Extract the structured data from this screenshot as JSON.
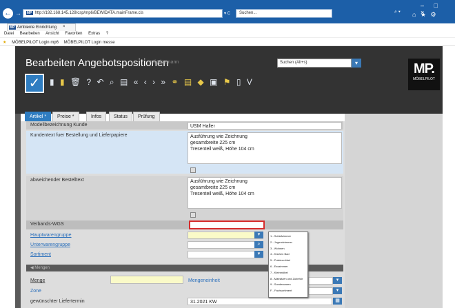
{
  "browser": {
    "url": "http://192.168.145.128/csp/mp6/BEWIDATA.mainFrame.cls",
    "address_controls": "▾ C",
    "search_placeholder": "Suchen...",
    "tab_title": "Ambiente Einrichtung",
    "tab_close": "×",
    "menu": [
      "Datei",
      "Bearbeiten",
      "Ansicht",
      "Favoriten",
      "Extras",
      "?"
    ],
    "favorites": [
      "MÖBELPILOT Login mp6",
      "MÖBELPILOT Login messe"
    ],
    "window_controls": "– □ ×",
    "tool_icons": "⌂ ★ ⚙",
    "search_icon": "⌕ ▾"
  },
  "app": {
    "title": "Bearbeiten Angebotspositionen",
    "user": "Uli Flottmann",
    "search_label": "Suchen (Alt+s)",
    "logo_big": "MP.",
    "logo_small": "MÖBELPILOT",
    "accent": "#2f7dc1",
    "toolbar_icons": [
      "file-icon",
      "document-icon",
      "delete-icon",
      "help-icon",
      "undo-icon",
      "search-icon",
      "print-icon",
      "first-icon",
      "prev-icon",
      "next-icon",
      "last-icon",
      "link-icon",
      "report-icon",
      "label-icon",
      "copy-icon",
      "flag-icon",
      "export-icon",
      "more-icon"
    ]
  },
  "tabs": [
    "Artikel *",
    "Preise *",
    "Infos",
    "Status",
    "Prüfung"
  ],
  "form": {
    "modell_label": "Modellbezeichnung Kunde",
    "modell_value": "USM Haller",
    "kundentext_label": "Kundentext fuer Bestellung und Lieferpapiere",
    "kundentext_value": "Ausführung wie Zeichnung\ngesamtbreite 225 cm\nTresenteil weiß, Höhe 104 cm",
    "abw_label": "abweichender Bestelltext",
    "abw_value": "Ausführung wie Zeichnung\ngesamtbreite 225 cm\nTresenteil weiß, Höhe 104 cm",
    "verbands_label": "Verbands-WGS",
    "verbands_value": "",
    "haupt_label": "Hauptwarengruppe",
    "unter_label": "Unterwarengruppe",
    "sortiment_label": "Sortiment",
    "mengen_label": "Mengen",
    "menge_label": "Menge",
    "mengeneinheit_label": "Mengeneinheit",
    "zone_label": "Zone",
    "liefertermin_label": "gewünschter Liefertermin",
    "liefertermin_value": "31.2021 KW"
  },
  "popup_items": [
    "1 - Schlafzimmer",
    "2 - Jugendzimmer",
    "3 - Wohnen",
    "4 - Küchen Bad",
    "5 - Polstermöbel",
    "6 - Esszimmer",
    "7 - Kleinmöbel",
    "8 - Matratzen und Zubehör",
    "9 - Sonderwaren",
    "F - Fachsortiment"
  ]
}
